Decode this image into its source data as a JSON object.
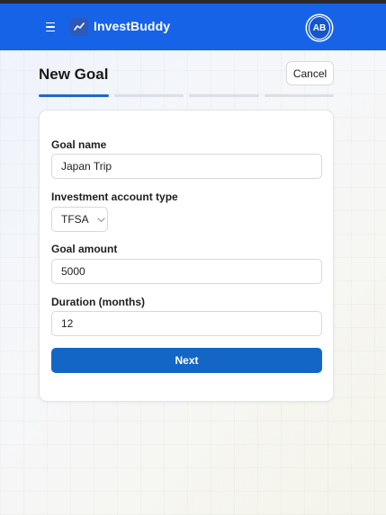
{
  "header": {
    "brand_name": "InvestBuddy",
    "avatar_initials": "AB",
    "menu_icon": "hamburger-menu-icon",
    "brand_icon": "trend-line-icon",
    "color": "#1763e8"
  },
  "page": {
    "title": "New Goal",
    "cancel_label": "Cancel",
    "progress": {
      "total_steps": 4,
      "current_step": 1
    }
  },
  "form": {
    "goal_name": {
      "label": "Goal name",
      "value": "Japan Trip"
    },
    "account_type": {
      "label": "Investment account type",
      "selected": "TFSA",
      "icon": "chevron-down-icon"
    },
    "goal_amount": {
      "label": "Goal amount",
      "value": "5000"
    },
    "duration": {
      "label": "Duration (months)",
      "value": "12"
    },
    "next_label": "Next",
    "accent": "#1366c5"
  }
}
